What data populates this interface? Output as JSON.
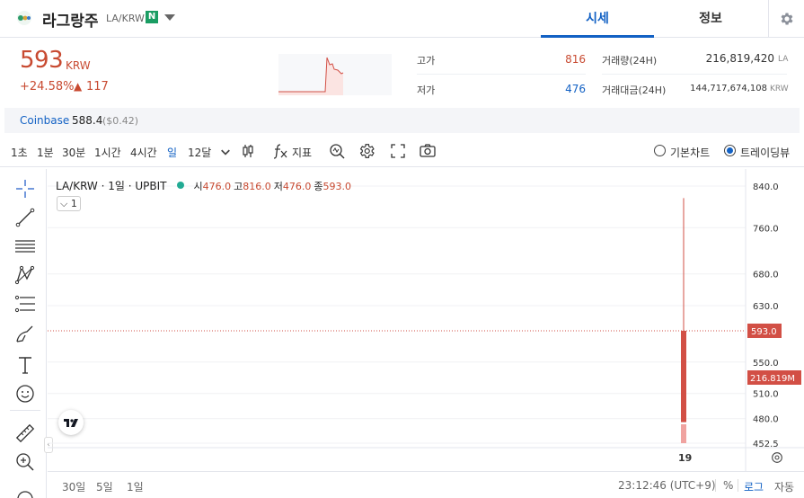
{
  "header": {
    "coin_name": "라그랑주",
    "pair": "LA/KRW",
    "new_badge": "N",
    "tabs": [
      {
        "label": "시세",
        "active": true
      },
      {
        "label": "정보",
        "active": false
      }
    ]
  },
  "summary": {
    "price": "593",
    "currency": "KRW",
    "change_rate": "+24.58%",
    "change_arrow": "▲",
    "change_amount": "117",
    "high_label": "고가",
    "high_value": "816",
    "low_label": "저가",
    "low_value": "476",
    "volume_label": "거래량(24H)",
    "volume_value": "216,819,420",
    "volume_unit": "LA",
    "trade_value_label": "거래대금(24H)",
    "trade_value_value": "144,717,674,108",
    "trade_value_unit": "KRW"
  },
  "coinbase": {
    "label": "Coinbase",
    "price": "588.4",
    "usd": "($0.42)"
  },
  "toolbar": {
    "timeframes": [
      "1초",
      "1분",
      "30분",
      "1시간",
      "4시간",
      "일",
      "12달"
    ],
    "active_timeframe": "일",
    "indicator_label": "지표",
    "chart_modes": [
      {
        "label": "기본차트",
        "selected": false
      },
      {
        "label": "트레이딩뷰",
        "selected": true
      }
    ]
  },
  "chart": {
    "legend_symbol": "LA/KRW · 1일 · UPBIT",
    "legend_open_key": "시",
    "legend_open": "476.0",
    "legend_high_key": "고",
    "legend_high": "816.0",
    "legend_low_key": "저",
    "legend_low": "476.0",
    "legend_close_key": "종",
    "legend_close": "593.0",
    "indicator_count": "1",
    "price_labels": [
      "840.0",
      "760.0",
      "680.0",
      "630.0",
      "550.0",
      "510.0",
      "480.0",
      "452.5"
    ],
    "current_price_tag": "593.0",
    "volume_tag": "216.819M",
    "time_label": "19",
    "colors": {
      "up": "#d24f45",
      "volume": "#f0a3a0",
      "axis_text": "#333333"
    }
  },
  "chart_data": {
    "type": "candlestick",
    "x": [
      "19"
    ],
    "open": [
      476.0
    ],
    "high": [
      816.0
    ],
    "low": [
      476.0
    ],
    "close": [
      593.0
    ],
    "volume": [
      216819420
    ],
    "y_ticks": [
      840.0,
      760.0,
      680.0,
      630.0,
      550.0,
      510.0,
      480.0,
      452.5
    ],
    "ylim": [
      452.5,
      840.0
    ],
    "y_scale": "log"
  },
  "bottom_bar": {
    "ranges": [
      "30일",
      "5일",
      "1일"
    ],
    "clock": "23:12:46 (UTC+9)",
    "percent": "%",
    "log": "로그",
    "auto": "자동"
  }
}
